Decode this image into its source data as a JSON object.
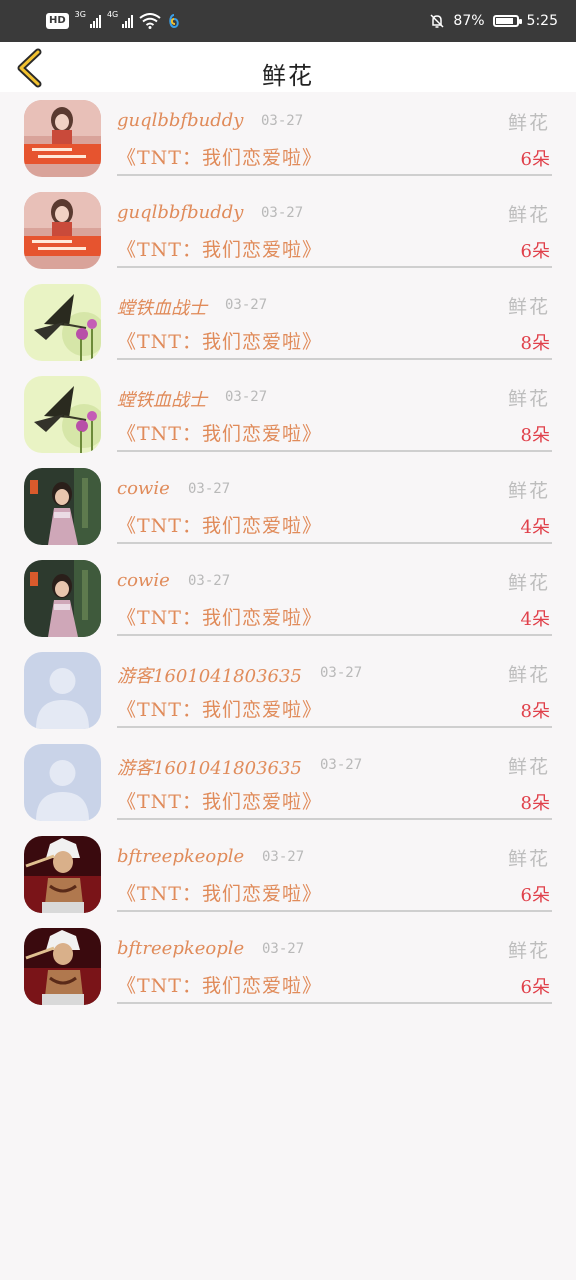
{
  "status_bar": {
    "left": {
      "hd": "HD",
      "net1": "3G",
      "net2": "4G"
    },
    "battery_percent": "87%",
    "battery_level": 0.87,
    "time": "5:25"
  },
  "header": {
    "title": "鲜花"
  },
  "icons": {
    "back": "chevron-left-icon",
    "wifi": "wifi-icon",
    "mute": "bell-off-icon",
    "battery": "battery-icon"
  },
  "colors": {
    "accent": "#e08b5a",
    "count": "#e0404a",
    "muted": "#bdbdbd"
  },
  "rows": [
    {
      "user": "guqlbbfbuddy",
      "date": "03-27",
      "label": "鲜花",
      "show": "《TNT：我们恋爱啦》",
      "count": "6朵",
      "avatar": "avatar-girl-banner-icon"
    },
    {
      "user": "guqlbbfbuddy",
      "date": "03-27",
      "label": "鲜花",
      "show": "《TNT：我们恋爱啦》",
      "count": "6朵",
      "avatar": "avatar-girl-banner-icon"
    },
    {
      "user": "螳铁血战士",
      "date": "03-27",
      "label": "鲜花",
      "show": "《TNT：我们恋爱啦》",
      "count": "8朵",
      "avatar": "avatar-butterfly-icon"
    },
    {
      "user": "螳铁血战士",
      "date": "03-27",
      "label": "鲜花",
      "show": "《TNT：我们恋爱啦》",
      "count": "8朵",
      "avatar": "avatar-butterfly-icon"
    },
    {
      "user": "cowie",
      "date": "03-27",
      "label": "鲜花",
      "show": "《TNT：我们恋爱啦》",
      "count": "4朵",
      "avatar": "avatar-woman-night-icon"
    },
    {
      "user": "cowie",
      "date": "03-27",
      "label": "鲜花",
      "show": "《TNT：我们恋爱啦》",
      "count": "4朵",
      "avatar": "avatar-woman-night-icon"
    },
    {
      "user": "游客1601041803635",
      "date": "03-27",
      "label": "鲜花",
      "show": "《TNT：我们恋爱啦》",
      "count": "8朵",
      "avatar": "avatar-default-person-icon"
    },
    {
      "user": "游客1601041803635",
      "date": "03-27",
      "label": "鲜花",
      "show": "《TNT：我们恋爱啦》",
      "count": "8朵",
      "avatar": "avatar-default-person-icon"
    },
    {
      "user": "bftreepkeople",
      "date": "03-27",
      "label": "鲜花",
      "show": "《TNT：我们恋爱啦》",
      "count": "6朵",
      "avatar": "avatar-anime-warrior-icon"
    },
    {
      "user": "bftreepkeople",
      "date": "03-27",
      "label": "鲜花",
      "show": "《TNT：我们恋爱啦》",
      "count": "6朵",
      "avatar": "avatar-anime-warrior-icon"
    }
  ]
}
